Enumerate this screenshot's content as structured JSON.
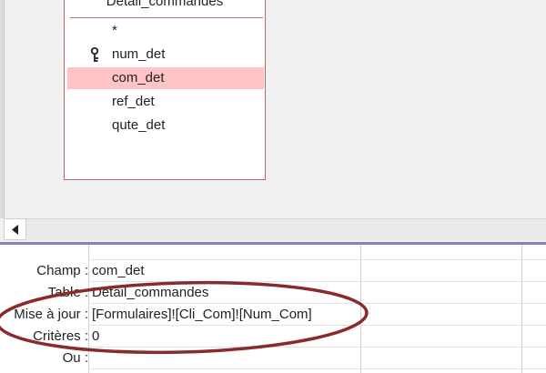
{
  "table": {
    "name": "Détail_commandes",
    "fields": [
      {
        "label": "*",
        "primary_key": false,
        "selected": false
      },
      {
        "label": "num_det",
        "primary_key": true,
        "selected": false
      },
      {
        "label": "com_det",
        "primary_key": false,
        "selected": true
      },
      {
        "label": "ref_det",
        "primary_key": false,
        "selected": false
      },
      {
        "label": "qute_det",
        "primary_key": false,
        "selected": false
      }
    ]
  },
  "grid": {
    "row_labels": {
      "champ": "Champ :",
      "table": "Table :",
      "mise_a_jour": "Mise à jour :",
      "criteres": "Critères :",
      "ou": "Ou :"
    },
    "column1": {
      "champ": "com_det",
      "table": "Détail_commandes",
      "mise_a_jour": "[Formulaires]![Cli_Com]![Num_Com]",
      "criteres": "0",
      "ou": ""
    }
  },
  "colors": {
    "selected_field": "#ffc4c6",
    "table_border": "#c46464",
    "splitter": "#8c7fbf",
    "annotation_ellipse": "#8b2a2a"
  },
  "icons": {
    "key": "key-icon",
    "scroll_left": "triangle-left-icon"
  }
}
